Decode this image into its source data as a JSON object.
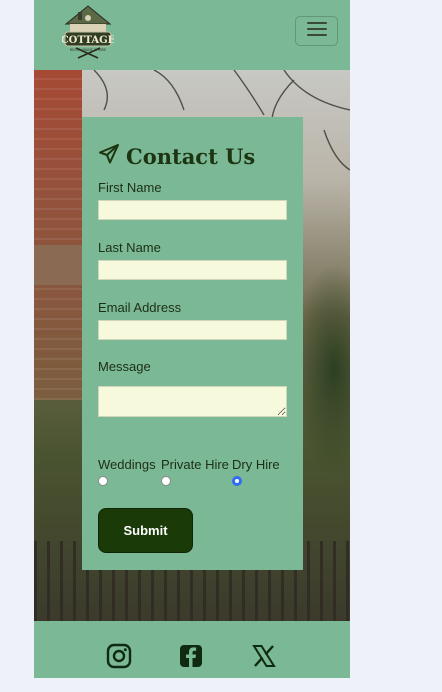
{
  "brand": {
    "logo_text": "COTTAGE",
    "logo_subtext": "RESTAURANT & HIRE",
    "icon": "cottage-logo"
  },
  "nav": {
    "toggle_icon": "hamburger-icon"
  },
  "contact": {
    "title": "Contact Us",
    "title_icon": "paper-plane-icon",
    "fields": [
      {
        "label": "First Name",
        "value": ""
      },
      {
        "label": "Last Name",
        "value": ""
      },
      {
        "label": "Email Address",
        "value": ""
      }
    ],
    "message": {
      "label": "Message",
      "value": ""
    },
    "options": [
      {
        "label": "Weddings",
        "checked": false
      },
      {
        "label": "Private Hire",
        "checked": false
      },
      {
        "label": "Dry Hire",
        "checked": true
      }
    ],
    "submit_label": "Submit"
  },
  "footer": {
    "icons": [
      "instagram-icon",
      "facebook-icon",
      "x-icon"
    ]
  },
  "colors": {
    "primary_green": "#7ab896",
    "dark_green": "#1a3a07",
    "input_bg": "#f7f9dc",
    "page_bg": "#eef1fa",
    "radio_accent": "#2f6cf5"
  }
}
